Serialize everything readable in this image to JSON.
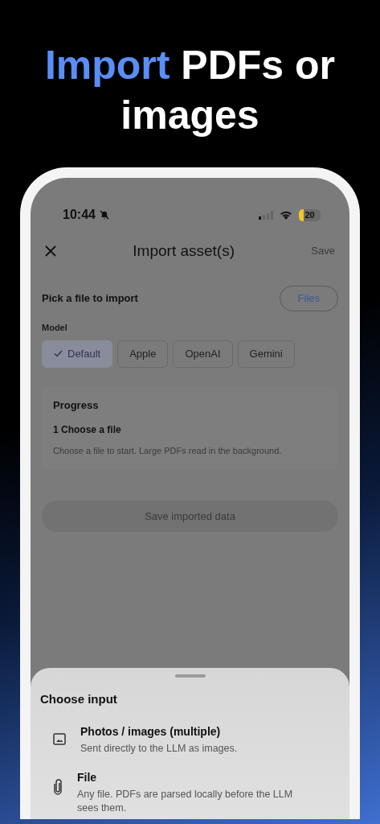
{
  "headline": {
    "highlight": "Import",
    "rest": "PDFs or images"
  },
  "status_bar": {
    "time": "10:44",
    "battery": "20"
  },
  "header": {
    "title": "Import asset(s)",
    "save": {
      "label": "Save",
      "disabled": true
    }
  },
  "pick": {
    "label": "Pick a file to import",
    "button": "Files"
  },
  "model": {
    "label": "Model",
    "options": [
      {
        "label": "Default",
        "selected": true
      },
      {
        "label": "Apple",
        "selected": false
      },
      {
        "label": "OpenAI",
        "selected": false
      },
      {
        "label": "Gemini",
        "selected": false
      }
    ]
  },
  "progress": {
    "title": "Progress",
    "step": "1 Choose a file",
    "description": "Choose a file to start. Large PDFs read in the background."
  },
  "save_button": {
    "label": "Save imported data",
    "disabled": true
  },
  "sheet": {
    "title": "Choose input",
    "options": [
      {
        "kind": "photos",
        "title": "Photos / images (multiple)",
        "subtitle": "Sent directly to the LLM as images."
      },
      {
        "kind": "file",
        "title": "File",
        "subtitle": "Any file. PDFs are parsed locally before the LLM sees them."
      }
    ]
  }
}
